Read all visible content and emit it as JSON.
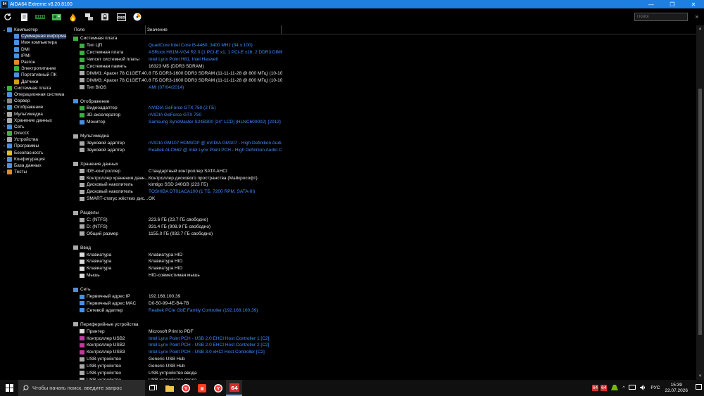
{
  "window": {
    "title": "AIDA64 Extreme v8.20.8100",
    "app_icon_text": "64",
    "minimize": "—",
    "maximize": "❐",
    "close": "✕"
  },
  "toolbar": {
    "search_placeholder": "Поиск",
    "more": "»",
    "icons": [
      "refresh-icon",
      "report-icon",
      "ram-icon",
      "motherboard-icon",
      "flame-icon",
      "network-icon",
      "lock-icon",
      "osd-icon",
      "stability-icon"
    ]
  },
  "tree": {
    "items": [
      {
        "label": "Компьютер",
        "exp": "⌄",
        "level": 0,
        "color": "#4a90e2"
      },
      {
        "label": "Суммарная информа",
        "exp": "",
        "level": 1,
        "color": "#4a90e2",
        "selected": true
      },
      {
        "label": "Имя компьютера",
        "exp": "",
        "level": 1,
        "color": "#4a90e2"
      },
      {
        "label": "DMI",
        "exp": "",
        "level": 1,
        "color": "#4a90e2"
      },
      {
        "label": "IPMI",
        "exp": "",
        "level": 1,
        "color": "#4a90e2"
      },
      {
        "label": "Разгон",
        "exp": "",
        "level": 1,
        "color": "#e08a2a"
      },
      {
        "label": "Электропитание",
        "exp": "",
        "level": 1,
        "color": "#3cb043"
      },
      {
        "label": "Портативный ПК",
        "exp": "",
        "level": 1,
        "color": "#4a90e2"
      },
      {
        "label": "Датчики",
        "exp": "",
        "level": 1,
        "color": "#d4a017"
      },
      {
        "label": "Системная плата",
        "exp": "›",
        "level": 0,
        "color": "#3cb043"
      },
      {
        "label": "Операционная система",
        "exp": "›",
        "level": 0,
        "color": "#4a90e2"
      },
      {
        "label": "Сервер",
        "exp": "›",
        "level": 0,
        "color": "#888888"
      },
      {
        "label": "Отображение",
        "exp": "›",
        "level": 0,
        "color": "#4a90e2"
      },
      {
        "label": "Мультимедиа",
        "exp": "›",
        "level": 0,
        "color": "#aaaaaa"
      },
      {
        "label": "Хранение данных",
        "exp": "›",
        "level": 0,
        "color": "#aaaaaa"
      },
      {
        "label": "Сеть",
        "exp": "›",
        "level": 0,
        "color": "#4a90e2"
      },
      {
        "label": "DirectX",
        "exp": "›",
        "level": 0,
        "color": "#3cb043"
      },
      {
        "label": "Устройства",
        "exp": "›",
        "level": 0,
        "color": "#aaaaaa"
      },
      {
        "label": "Программы",
        "exp": "›",
        "level": 0,
        "color": "#4a90e2"
      },
      {
        "label": "Безопасность",
        "exp": "›",
        "level": 0,
        "color": "#e0c020"
      },
      {
        "label": "Конфигурация",
        "exp": "›",
        "level": 0,
        "color": "#4a90e2"
      },
      {
        "label": "База данных",
        "exp": "›",
        "level": 0,
        "color": "#4a90e2"
      },
      {
        "label": "Тесты",
        "exp": "›",
        "level": 0,
        "color": "#e08a2a"
      }
    ]
  },
  "columns": {
    "field": "Поле",
    "value": "Значение"
  },
  "rows": [
    {
      "type": "group",
      "label": "Системная плата",
      "color": "#3cb043"
    },
    {
      "type": "item",
      "field": "Тип ЦП",
      "value": "QuadCore Intel Core i5-4460, 3400 MHz (34 x 100)",
      "link": true,
      "color": "#3cb043"
    },
    {
      "type": "item",
      "field": "Системная плата",
      "value": "ASRock H81M-VG4 R2.0  (1 PCI-E x1, 1 PCI-E x16, 2 DDR3 DIMM, A...",
      "link": true,
      "color": "#3cb043"
    },
    {
      "type": "item",
      "field": "Чипсет системной платы",
      "value": "Intel Lynx Point H81, Intel Haswell",
      "link": true,
      "color": "#3cb043"
    },
    {
      "type": "item",
      "field": "Системная память",
      "value": "16323 МБ  (DDR3 SDRAM)",
      "link": false,
      "color": "#3cb043"
    },
    {
      "type": "item",
      "field": "DIMM1: Apacer 78.C1GET.40...",
      "value": "8 ГБ DDR3-1600 DDR3 SDRAM  (11-11-11-28 @ 800 МГц)  (10-10-1...",
      "link": false,
      "color": "#aaaaaa"
    },
    {
      "type": "item",
      "field": "DIMM3: Apacer 78.C1GET.40...",
      "value": "8 ГБ DDR3-1600 DDR3 SDRAM  (11-11-11-28 @ 800 МГц)  (10-10-1...",
      "link": false,
      "color": "#aaaaaa"
    },
    {
      "type": "item",
      "field": "Тип BIOS",
      "value": "AMI (07/04/2014)",
      "link": true,
      "color": "#aaaaaa"
    },
    {
      "type": "gap"
    },
    {
      "type": "group",
      "label": "Отображение",
      "color": "#4a90e2"
    },
    {
      "type": "item",
      "field": "Видеоадаптер",
      "value": "NVIDIA GeForce GTX 750  (2 ГБ)",
      "link": true,
      "color": "#3cb043"
    },
    {
      "type": "item",
      "field": "3D-акселератор",
      "value": "nVIDIA GeForce GTX 750",
      "link": true,
      "color": "#3cb043"
    },
    {
      "type": "item",
      "field": "Монитор",
      "value": "Samsung SyncMaster S24B300  [24\" LCD]  (HLNC600002)  {2012}",
      "link": true,
      "color": "#4a90e2"
    },
    {
      "type": "gap"
    },
    {
      "type": "group",
      "label": "Мультимедиа",
      "color": "#aaaaaa"
    },
    {
      "type": "item",
      "field": "Звуковой адаптер",
      "value": "nVIDIA GM107 HDMI/DP @ nVIDIA GM107 - High Definition Audi...",
      "link": true,
      "color": "#aaaaaa"
    },
    {
      "type": "item",
      "field": "Звуковой адаптер",
      "value": "Realtek ALC662 @ Intel Lynx Point PCH - High Definition Audio C...",
      "link": true,
      "color": "#aaaaaa"
    },
    {
      "type": "gap"
    },
    {
      "type": "group",
      "label": "Хранение данных",
      "color": "#aaaaaa"
    },
    {
      "type": "item",
      "field": "IDE-контроллер",
      "value": "Стандартный контроллер SATA AHCI",
      "link": false,
      "color": "#aaaaaa"
    },
    {
      "type": "item",
      "field": "Контроллер хранения данн...",
      "value": "Контроллер дискового пространства (Майкрософт)",
      "link": false,
      "color": "#aaaaaa"
    },
    {
      "type": "item",
      "field": "Дисковый накопитель",
      "value": "kimtigo SSD 240GB  (223 ГБ)",
      "link": false,
      "color": "#aaaaaa"
    },
    {
      "type": "item",
      "field": "Дисковый накопитель",
      "value": "TOSHIBA DT01ACA100  (1 ТБ, 7200 RPM, SATA-III)",
      "link": true,
      "color": "#aaaaaa"
    },
    {
      "type": "item",
      "field": "SMART-статус жёстких дис...",
      "value": "OK",
      "link": false,
      "color": "#aaaaaa"
    },
    {
      "type": "gap"
    },
    {
      "type": "group",
      "label": "Разделы",
      "color": "#aaaaaa"
    },
    {
      "type": "item",
      "field": "C: (NTFS)",
      "value": "223.6 ГБ (23.7 ГБ свободно)",
      "link": false,
      "color": "#aaaaaa"
    },
    {
      "type": "item",
      "field": "D: (NTFS)",
      "value": "931.4 ГБ (908.9 ГБ свободно)",
      "link": false,
      "color": "#aaaaaa"
    },
    {
      "type": "item",
      "field": "Общий размер",
      "value": "1155.0 ГБ (932.7 ГБ свободно)",
      "link": false,
      "color": "#aaaaaa"
    },
    {
      "type": "gap"
    },
    {
      "type": "group",
      "label": "Ввод",
      "color": "#aaaaaa"
    },
    {
      "type": "item",
      "field": "Клавиатура",
      "value": "Клавиатура HID",
      "link": false,
      "color": "#dddddd"
    },
    {
      "type": "item",
      "field": "Клавиатура",
      "value": "Клавиатура HID",
      "link": false,
      "color": "#dddddd"
    },
    {
      "type": "item",
      "field": "Клавиатура",
      "value": "Клавиатура HID",
      "link": false,
      "color": "#dddddd"
    },
    {
      "type": "item",
      "field": "Мышь",
      "value": "HID-совместимая мышь",
      "link": false,
      "color": "#dddddd"
    },
    {
      "type": "gap"
    },
    {
      "type": "group",
      "label": "Сеть",
      "color": "#4a90e2"
    },
    {
      "type": "item",
      "field": "Первичный адрес IP",
      "value": "192.168.100.39",
      "link": false,
      "color": "#4a90e2"
    },
    {
      "type": "item",
      "field": "Первичный адрес MAC",
      "value": "D0-50-99-4E-B4-7B",
      "link": false,
      "color": "#4a90e2"
    },
    {
      "type": "item",
      "field": "Сетевой адаптер",
      "value": "Realtek PCIe GbE Family Controller  (192.168.100.39)",
      "link": true,
      "color": "#4a90e2"
    },
    {
      "type": "gap"
    },
    {
      "type": "group",
      "label": "Периферийные устройства",
      "color": "#aaaaaa"
    },
    {
      "type": "item",
      "field": "Принтер",
      "value": "Microsoft Print to PDF",
      "link": false,
      "color": "#dddddd"
    },
    {
      "type": "item",
      "field": "Контроллер USB2",
      "value": "Intel Lynx Point PCH - USB 2.0 EHCI Host Controller 1 [C2]",
      "link": true,
      "color": "#c03aa0"
    },
    {
      "type": "item",
      "field": "Контроллер USB2",
      "value": "Intel Lynx Point PCH - USB 2.0 EHCI Host Controller 2 [C2]",
      "link": true,
      "color": "#c03aa0"
    },
    {
      "type": "item",
      "field": "Контроллер USB3",
      "value": "Intel Lynx Point PCH - USB 3.0 xHCI Host Controller [C2]",
      "link": true,
      "color": "#c03aa0"
    },
    {
      "type": "item",
      "field": "USB-устройство",
      "value": "Generic USB Hub",
      "link": false,
      "color": "#aaaaaa"
    },
    {
      "type": "item",
      "field": "USB-устройство",
      "value": "Generic USB Hub",
      "link": false,
      "color": "#aaaaaa"
    },
    {
      "type": "item",
      "field": "USB-устройство",
      "value": "USB-устройство ввода",
      "link": false,
      "color": "#aaaaaa"
    },
    {
      "type": "item",
      "field": "USB-устройство",
      "value": "USB-устройство ввода",
      "link": false,
      "color": "#aaaaaa"
    }
  ],
  "taskbar": {
    "search_placeholder": "Чтобы начать поиск, введите запрос",
    "tray_badge": "64",
    "language": "РУС",
    "time": "15:39",
    "date": "22.07.2026"
  }
}
